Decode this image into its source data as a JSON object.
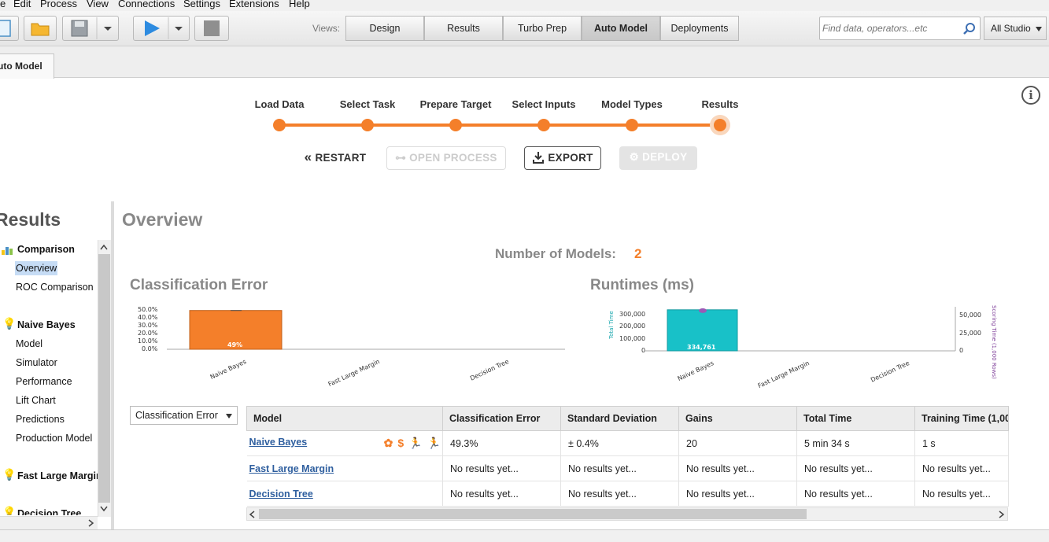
{
  "menu": [
    "e",
    "Edit",
    "Process",
    "View",
    "Connections",
    "Settings",
    "Extensions",
    "Help"
  ],
  "toolbar": {
    "views_label": "Views:",
    "views": [
      "Design",
      "Results",
      "Turbo Prep",
      "Auto Model",
      "Deployments"
    ],
    "active_view": "Auto Model",
    "search_placeholder": "Find data, operators...etc",
    "studio_select": "All Studio"
  },
  "tab": {
    "label": "uto Model"
  },
  "stepper": {
    "steps": [
      "Load Data",
      "Select Task",
      "Prepare Target",
      "Select Inputs",
      "Model Types",
      "Results"
    ],
    "current": "Results",
    "restart_label": "RESTART",
    "open_process_label": "OPEN PROCESS",
    "export_label": "EXPORT",
    "deploy_label": "DEPLOY"
  },
  "sidebar": {
    "title": "Results",
    "groups": [
      {
        "label": "Comparison",
        "items": [
          "Overview",
          "ROC Comparison"
        ]
      },
      {
        "label": "Naive Bayes",
        "items": [
          "Model",
          "Simulator",
          "Performance",
          "Lift Chart",
          "Predictions",
          "Production Model"
        ]
      },
      {
        "label": "Fast Large Margin",
        "items": []
      },
      {
        "label": "Decision Tree",
        "items": []
      }
    ],
    "selected": "Overview"
  },
  "main": {
    "title": "Overview",
    "models_label": "Number of Models:",
    "models_count": "2",
    "classification_error_title": "Classification Error",
    "runtimes_title": "Runtimes (ms)"
  },
  "chart_data": [
    {
      "type": "bar",
      "title": "Classification Error",
      "categories": [
        "Naive Bayes",
        "Fast Large Margin",
        "Decision Tree"
      ],
      "values": [
        49.3,
        null,
        null
      ],
      "data_labels": [
        "49%",
        "",
        ""
      ],
      "yticks": [
        "50.0%",
        "40.0%",
        "30.0%",
        "20.0%",
        "10.0%",
        "0.0%"
      ],
      "ylim": [
        0,
        50
      ],
      "color": "#f47f2a"
    },
    {
      "type": "bar",
      "title": "Runtimes (ms)",
      "categories": [
        "Naive Bayes",
        "Fast Large Margin",
        "Decision Tree"
      ],
      "values": [
        334761,
        null,
        null
      ],
      "data_labels": [
        "334,761",
        "",
        ""
      ],
      "ylabel": "Total Time",
      "y2label": "Scoring Time (1,000 Rows)",
      "yticks": [
        "300,000",
        "200,000",
        "100,000",
        "0"
      ],
      "y2ticks": [
        "50,000",
        "25,000",
        "0"
      ],
      "ylim": [
        0,
        340000
      ],
      "color": "#18c1c8",
      "marker_color": "#9b59b6"
    }
  ],
  "table": {
    "metric_select": "Classification Error",
    "columns": [
      "Model",
      "Classification Error",
      "Standard Deviation",
      "Gains",
      "Total Time",
      "Training Time (1,00"
    ],
    "rows": [
      {
        "model": "Naive Bayes",
        "cells": [
          "49.3%",
          "± 0.4%",
          "20",
          "5 min 34 s",
          "1 s"
        ],
        "badges": true
      },
      {
        "model": "Fast Large Margin",
        "cells": [
          "No results yet...",
          "No results yet...",
          "No results yet...",
          "No results yet...",
          "No results yet..."
        ],
        "badges": false
      },
      {
        "model": "Decision Tree",
        "cells": [
          "No results yet...",
          "No results yet...",
          "No results yet...",
          "No results yet...",
          "No results yet..."
        ],
        "badges": false
      }
    ],
    "badge_icons": [
      {
        "name": "ribbon-icon",
        "glyph": "✿",
        "color": "#f47f2a"
      },
      {
        "name": "dollar-icon",
        "glyph": "$",
        "color": "#f47f2a"
      },
      {
        "name": "runner-purple-icon",
        "glyph": "🏃",
        "color": "#9b59b6"
      },
      {
        "name": "runner-teal-icon",
        "glyph": "🏃",
        "color": "#18c1c8"
      }
    ]
  }
}
